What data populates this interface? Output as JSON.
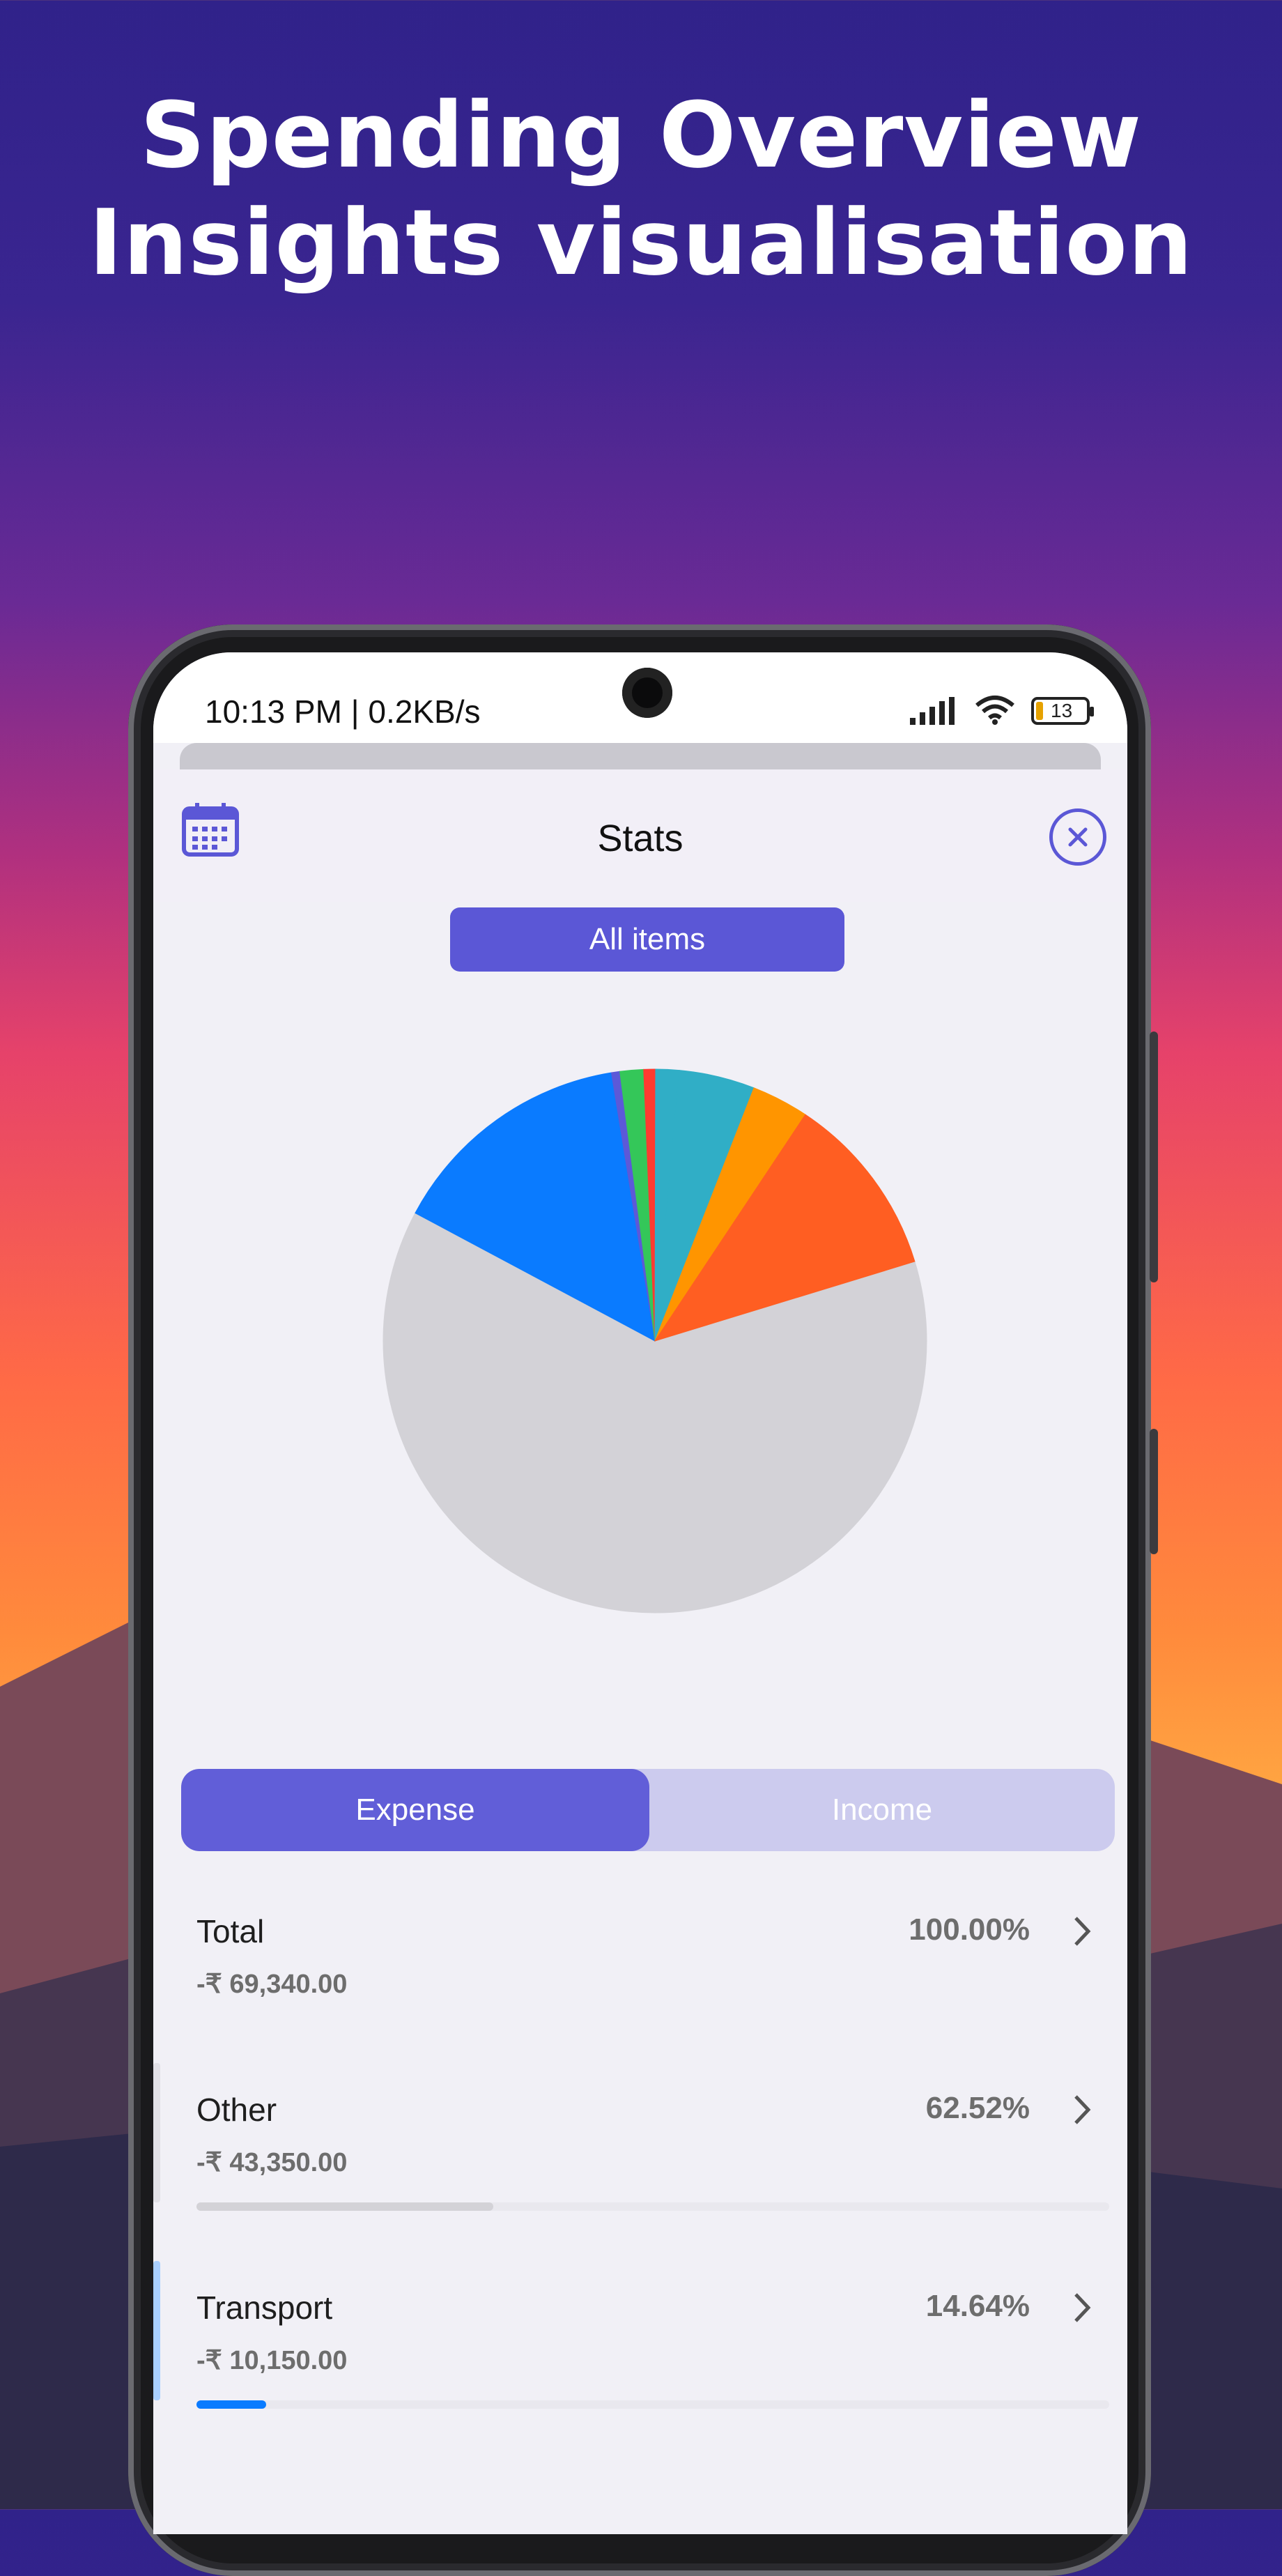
{
  "promo": {
    "line1": "Spending Overview",
    "line2": "Insights visualisation"
  },
  "status_bar": {
    "time": "10:13 PM | 0.2KB/s",
    "battery": "13",
    "icons": [
      "signal-icon",
      "wifi-icon",
      "battery-icon"
    ]
  },
  "header": {
    "title": "Stats",
    "calendar_icon": "calendar-icon",
    "close_icon": "close-icon"
  },
  "filter": {
    "label": "All items"
  },
  "chart_data": {
    "type": "pie",
    "slices": [
      {
        "label": "Other",
        "value": 62.52,
        "color": "#d3d2d7"
      },
      {
        "label": "Transport",
        "value": 14.64,
        "color": "#0a7bff"
      },
      {
        "label": "",
        "value": 0.5,
        "color": "#5c59d8"
      },
      {
        "label": "",
        "value": 1.4,
        "color": "#34c759"
      },
      {
        "label": "",
        "value": 0.7,
        "color": "#ff3b30"
      },
      {
        "label": "",
        "value": 1.4,
        "color": "#30aec6"
      },
      {
        "label": "",
        "value": 4.5,
        "color": "#30aec6"
      },
      {
        "label": "",
        "value": 3.4,
        "color": "#ff9500"
      },
      {
        "label": "",
        "value": 10.94,
        "color": "#ff5e22"
      }
    ]
  },
  "toggle": {
    "expense": "Expense",
    "income": "Income",
    "active": "expense"
  },
  "rows": [
    {
      "name": "Total",
      "amount": "-₹ 69,340.00",
      "percent": "100.00%",
      "share": 100,
      "color": "",
      "accent": ""
    },
    {
      "name": "Other",
      "amount": "-₹ 43,350.00",
      "percent": "62.52%",
      "share": 62.52,
      "color": "#d3d2d7",
      "accent": "#e2e1e7"
    },
    {
      "name": "Transport",
      "amount": "-₹ 10,150.00",
      "percent": "14.64%",
      "share": 14.64,
      "color": "#0a7bff",
      "accent": "#a9cfff"
    }
  ]
}
